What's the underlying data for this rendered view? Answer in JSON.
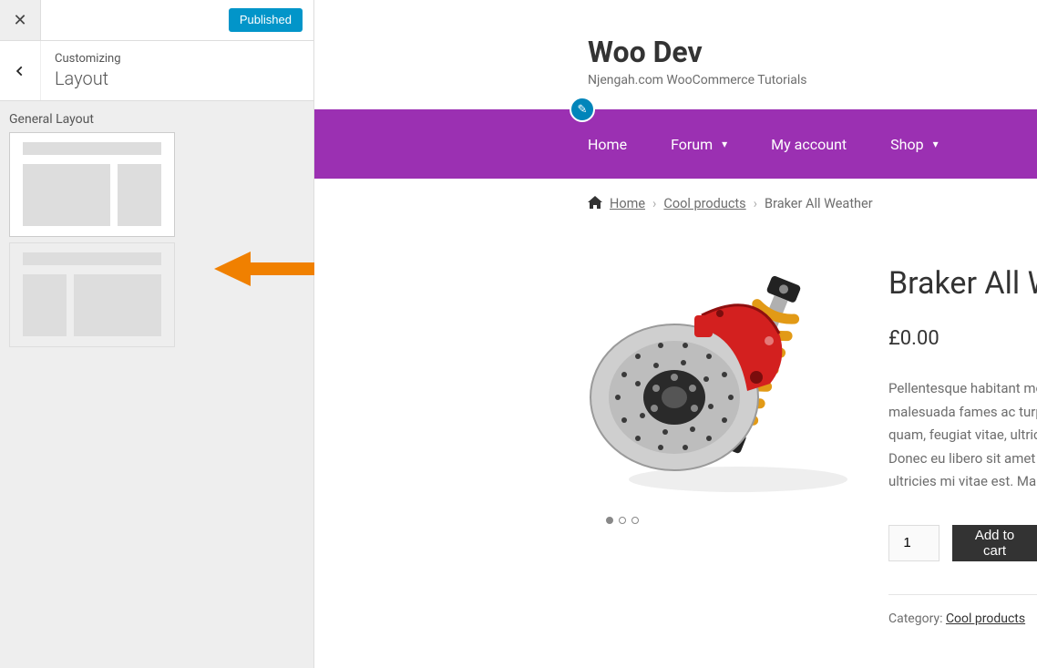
{
  "customizer": {
    "published_label": "Published",
    "customizing_label": "Customizing",
    "section_name": "Layout",
    "control_label": "General Layout"
  },
  "site": {
    "title": "Woo Dev",
    "tagline": "Njengah.com WooCommerce Tutorials"
  },
  "nav": {
    "items": [
      {
        "label": "Home",
        "has_children": false
      },
      {
        "label": "Forum",
        "has_children": true
      },
      {
        "label": "My account",
        "has_children": false
      },
      {
        "label": "Shop",
        "has_children": true
      }
    ]
  },
  "breadcrumbs": {
    "home": "Home",
    "cat": "Cool products",
    "current": "Braker All Weather"
  },
  "product": {
    "title": "Braker All W",
    "price": "£0.00",
    "desc_l1": "Pellentesque habitant morb",
    "desc_l2": "malesuada fames ac turpis e",
    "desc_l3": "quam, feugiat vitae, ultricie",
    "desc_l4": "Donec eu libero sit amet qu",
    "desc_l5": "ultricies mi vitae est. Mauris",
    "qty": "1",
    "add_to_cart": "Add to cart",
    "category_label": "Category: ",
    "category_link": "Cool products"
  }
}
